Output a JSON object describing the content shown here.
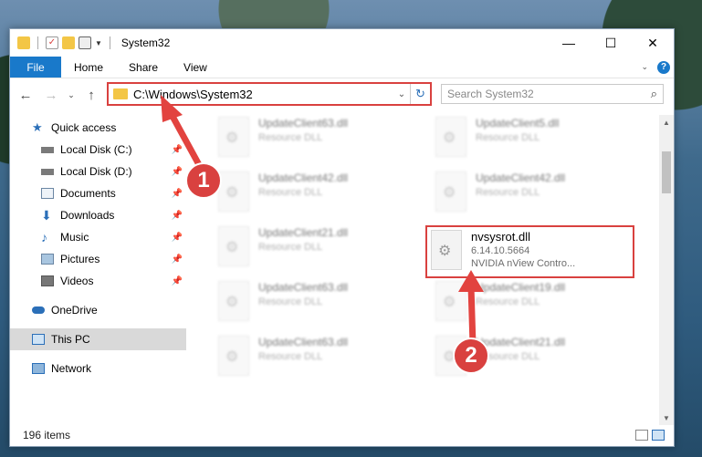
{
  "window": {
    "title": "System32"
  },
  "ribbon": {
    "file": "File",
    "tabs": [
      "Home",
      "Share",
      "View"
    ],
    "help": "?"
  },
  "address": {
    "path": "C:\\Windows\\System32"
  },
  "search": {
    "placeholder": "Search System32"
  },
  "sidebar": {
    "quick_access": "Quick access",
    "items": [
      {
        "label": "Local Disk (C:)",
        "icon": "drive-icon"
      },
      {
        "label": "Local Disk (D:)",
        "icon": "drive-icon"
      },
      {
        "label": "Documents",
        "icon": "documents-icon"
      },
      {
        "label": "Downloads",
        "icon": "downloads-icon"
      },
      {
        "label": "Music",
        "icon": "music-icon"
      },
      {
        "label": "Pictures",
        "icon": "pictures-icon"
      },
      {
        "label": "Videos",
        "icon": "videos-icon"
      }
    ],
    "onedrive": "OneDrive",
    "this_pc": "This PC",
    "network": "Network"
  },
  "files": [
    {
      "name": "UpdateClient63.dll",
      "type": "Resource DLL"
    },
    {
      "name": "UpdateClient5.dll",
      "type": "Resource DLL"
    },
    {
      "name": "UpdateClient42.dll",
      "type": "Resource DLL"
    },
    {
      "name": "UpdateClient42.dll",
      "type": "Resource DLL"
    },
    {
      "name": "UpdateClient21.dll",
      "type": "Resource DLL"
    },
    {
      "name": "UpdateClient63.dll",
      "type": "Resource DLL"
    },
    {
      "name": "UpdateClient19.dll",
      "type": "Resource DLL"
    },
    {
      "name": "UpdateClient63.dll",
      "type": "Resource DLL"
    },
    {
      "name": "UpdateClient21.dll",
      "type": "Resource DLL"
    }
  ],
  "selected_file": {
    "name": "nvsysrot.dll",
    "version": "6.14.10.5664",
    "description": "NVIDIA nView Contro..."
  },
  "callouts": [
    "1",
    "2"
  ],
  "status": {
    "items": "196 items"
  },
  "colors": {
    "accent": "#1979ca",
    "highlight": "#d9413f"
  }
}
